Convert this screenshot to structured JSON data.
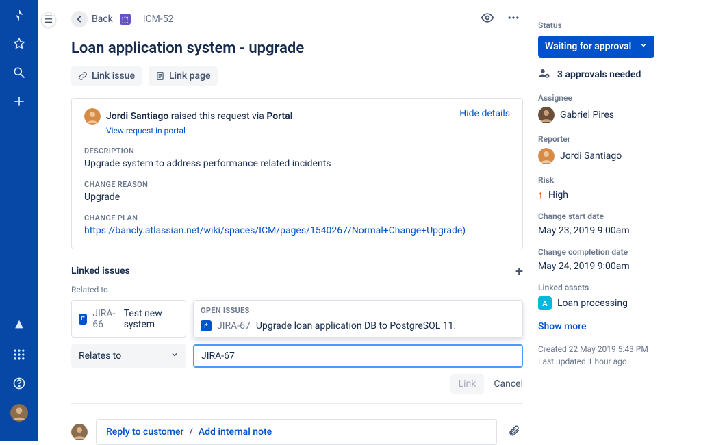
{
  "header": {
    "back": "Back",
    "issue_key": "ICM-52",
    "title": "Loan application system - upgrade"
  },
  "actions": {
    "link_issue": "Link issue",
    "link_page": "Link page"
  },
  "request": {
    "requester": "Jordi Santiago",
    "raised_middle": " raised this request via ",
    "raised_source": "Portal",
    "view_in_portal": "View request in portal",
    "hide_details": "Hide details",
    "description_label": "Description",
    "description": "Upgrade system to address performance related incidents",
    "change_reason_label": "Change reason",
    "change_reason": "Upgrade",
    "change_plan_label": "Change plan",
    "change_plan_link": "https://bancly.atlassian.net/wiki/spaces/ICM/pages/1540267/Normal+Change+Upgrade)"
  },
  "linked": {
    "section_title": "Linked issues",
    "related_to_label": "Related to",
    "existing": {
      "key": "JIRA-66",
      "summary": "Test new system"
    },
    "popup_heading": "Open issues",
    "suggestion": {
      "key": "JIRA-67",
      "summary": "Upgrade loan application DB to PostgreSQL 11."
    },
    "relation_select": "Relates to",
    "input_value": "JIRA-67",
    "link_btn": "Link",
    "cancel_btn": "Cancel"
  },
  "reply": {
    "reply_customer": "Reply to customer",
    "add_note": "Add internal note"
  },
  "sidebar": {
    "status_label": "Status",
    "status_value": "Waiting for approval",
    "approvals": "3 approvals needed",
    "assignee_label": "Assignee",
    "assignee": "Gabriel Pires",
    "reporter_label": "Reporter",
    "reporter": "Jordi Santiago",
    "risk_label": "Risk",
    "risk": "High",
    "start_label": "Change start date",
    "start": "May 23, 2019 9:00am",
    "end_label": "Change completion date",
    "end": "May 24, 2019 9:00am",
    "assets_label": "Linked assets",
    "asset": "Loan processing",
    "show_more": "Show more",
    "created": "Created 22 May 2019 5:43 PM",
    "updated": "Last updated 1 hour ago"
  }
}
